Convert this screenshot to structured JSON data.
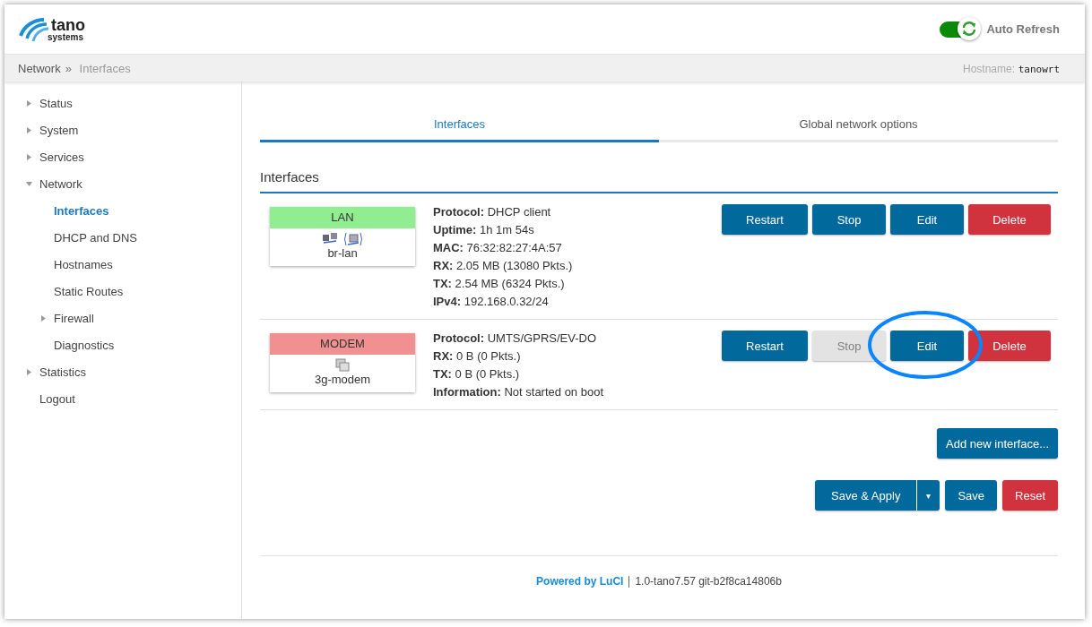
{
  "header": {
    "logo": {
      "name": "tano",
      "sub": "systems"
    },
    "auto_refresh": {
      "label": "Auto Refresh",
      "on": true
    }
  },
  "breadcrumb": {
    "items": [
      "Network",
      "Interfaces"
    ],
    "separator": "»",
    "hostname_label": "Hostname:",
    "hostname": "tanowrt"
  },
  "sidebar": {
    "items": [
      {
        "label": "Status",
        "kind": "group",
        "expanded": false,
        "selected": false
      },
      {
        "label": "System",
        "kind": "group",
        "expanded": false,
        "selected": false
      },
      {
        "label": "Services",
        "kind": "group",
        "expanded": false,
        "selected": false
      },
      {
        "label": "Network",
        "kind": "group",
        "expanded": true,
        "selected": false,
        "children": [
          {
            "label": "Interfaces",
            "kind": "link",
            "selected": true
          },
          {
            "label": "DHCP and DNS",
            "kind": "link",
            "selected": false
          },
          {
            "label": "Hostnames",
            "kind": "link",
            "selected": false
          },
          {
            "label": "Static Routes",
            "kind": "link",
            "selected": false
          },
          {
            "label": "Firewall",
            "kind": "group",
            "expanded": false,
            "selected": false
          },
          {
            "label": "Diagnostics",
            "kind": "link",
            "selected": false
          }
        ]
      },
      {
        "label": "Statistics",
        "kind": "group",
        "expanded": false,
        "selected": false
      },
      {
        "label": "Logout",
        "kind": "link",
        "selected": false
      }
    ]
  },
  "tabs": [
    {
      "label": "Interfaces",
      "selected": true
    },
    {
      "label": "Global network options",
      "selected": false
    }
  ],
  "section_title": "Interfaces",
  "interfaces": [
    {
      "name": "LAN",
      "color": "#90ee90",
      "device": "br-lan",
      "kind": "bridge",
      "details": [
        {
          "label": "Protocol:",
          "value": "DHCP client"
        },
        {
          "label": "Uptime:",
          "value": "1h 1m 54s"
        },
        {
          "label": "MAC:",
          "value": "76:32:82:27:4A:57"
        },
        {
          "label": "RX:",
          "value": "2.05 MB (13080 Pkts.)"
        },
        {
          "label": "TX:",
          "value": "2.54 MB (6324 Pkts.)"
        },
        {
          "label": "IPv4:",
          "value": "192.168.0.32/24"
        }
      ],
      "buttons": [
        {
          "label": "Restart",
          "kind": "primary",
          "disabled": false
        },
        {
          "label": "Stop",
          "kind": "primary",
          "disabled": false
        },
        {
          "label": "Edit",
          "kind": "primary",
          "disabled": false
        },
        {
          "label": "Delete",
          "kind": "danger",
          "disabled": false
        }
      ]
    },
    {
      "name": "MODEM",
      "color": "#f09090",
      "device": "3g-modem",
      "kind": "modem",
      "details": [
        {
          "label": "Protocol:",
          "value": "UMTS/GPRS/EV-DO"
        },
        {
          "label": "RX:",
          "value": "0 B (0 Pkts.)"
        },
        {
          "label": "TX:",
          "value": "0 B (0 Pkts.)"
        },
        {
          "label": "Information:",
          "value": "Not started on boot"
        }
      ],
      "buttons": [
        {
          "label": "Restart",
          "kind": "primary",
          "disabled": false
        },
        {
          "label": "Stop",
          "kind": "primary",
          "disabled": true
        },
        {
          "label": "Edit",
          "kind": "primary",
          "disabled": false
        },
        {
          "label": "Delete",
          "kind": "danger",
          "disabled": false
        }
      ]
    }
  ],
  "add_button": "Add new interface...",
  "actions": [
    {
      "label": "Save & Apply",
      "kind": "split"
    },
    {
      "label": "Save",
      "kind": "primary"
    },
    {
      "label": "Reset",
      "kind": "danger"
    }
  ],
  "split_caret": "▾",
  "footer": {
    "link": "Powered by LuCI",
    "version": "1.0-tano7.57 git-b2f8ca14806b"
  }
}
